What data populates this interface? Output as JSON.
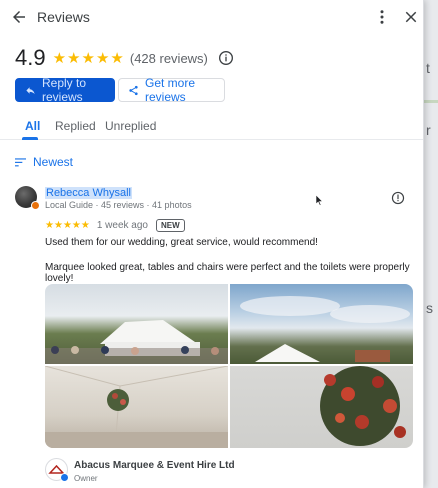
{
  "background": {
    "fragments": [
      "t",
      "r",
      "s"
    ]
  },
  "header": {
    "title": "Reviews"
  },
  "summary": {
    "rating": "4.9",
    "stars": [
      "★",
      "★",
      "★",
      "★",
      "★"
    ],
    "review_count": "(428 reviews)"
  },
  "actions": {
    "reply_label": "Reply to reviews",
    "more_label": "Get more reviews"
  },
  "tabs": [
    "All",
    "Replied",
    "Unreplied"
  ],
  "sort": {
    "label": "Newest"
  },
  "review": {
    "reviewer": "Rebecca Whysall",
    "meta": "Local Guide · 45 reviews · 41 photos",
    "stars": [
      "★",
      "★",
      "★",
      "★",
      "★"
    ],
    "time": "1 week ago",
    "badge": "NEW",
    "text_1": "Used them for our wedding, great service, would recommend!",
    "text_2": "Marquee looked great, tables and chairs were perfect and the toilets were properly lovely!"
  },
  "owner": {
    "name": "Abacus Marquee & Event Hire Ltd",
    "role": "Owner"
  },
  "colors": {
    "accent": "#1a73e8",
    "primary_button": "#0b57d0",
    "star": "#fbbc04"
  }
}
